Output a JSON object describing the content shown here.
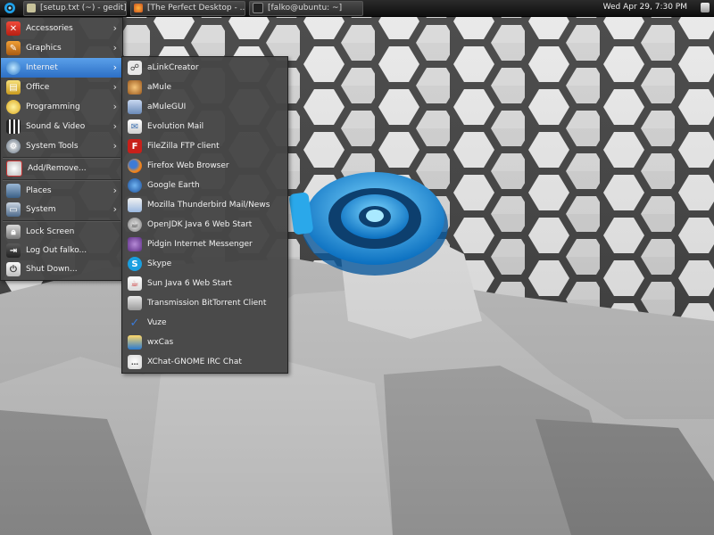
{
  "panel": {
    "tasks": [
      {
        "label": "[setup.txt (~) - gedit]"
      },
      {
        "label": "[The Perfect Desktop - ..."
      },
      {
        "label": "[falko@ubuntu: ~]"
      }
    ],
    "clock": "Wed Apr 29,  7:30 PM"
  },
  "main_menu": {
    "items": [
      {
        "label": "Accessories",
        "icon": "accessories-icon",
        "submenu": true
      },
      {
        "label": "Graphics",
        "icon": "graphics-icon",
        "submenu": true
      },
      {
        "label": "Internet",
        "icon": "internet-icon",
        "submenu": true,
        "highlighted": true
      },
      {
        "label": "Office",
        "icon": "office-icon",
        "submenu": true
      },
      {
        "label": "Programming",
        "icon": "programming-icon",
        "submenu": true
      },
      {
        "label": "Sound & Video",
        "icon": "sound-video-icon",
        "submenu": true
      },
      {
        "label": "System Tools",
        "icon": "system-tools-icon",
        "submenu": true
      },
      {
        "label": "Add/Remove...",
        "icon": "add-remove-icon"
      },
      {
        "label": "Places",
        "icon": "places-icon",
        "submenu": true
      },
      {
        "label": "System",
        "icon": "system-icon",
        "submenu": true
      },
      {
        "label": "Lock Screen",
        "icon": "lock-icon"
      },
      {
        "label": "Log Out falko...",
        "icon": "logout-icon"
      },
      {
        "label": "Shut Down...",
        "icon": "shutdown-icon"
      }
    ]
  },
  "internet_menu": {
    "items": [
      {
        "label": "aLinkCreator",
        "icon": "alinkcreator-icon"
      },
      {
        "label": "aMule",
        "icon": "amule-icon"
      },
      {
        "label": "aMuleGUI",
        "icon": "amulegui-icon"
      },
      {
        "label": "Evolution Mail",
        "icon": "evolution-icon"
      },
      {
        "label": "FileZilla FTP client",
        "icon": "filezilla-icon"
      },
      {
        "label": "Firefox Web Browser",
        "icon": "firefox-icon"
      },
      {
        "label": "Google Earth",
        "icon": "google-earth-icon"
      },
      {
        "label": "Mozilla Thunderbird Mail/News",
        "icon": "thunderbird-icon"
      },
      {
        "label": "OpenJDK Java 6 Web Start",
        "icon": "java-icon"
      },
      {
        "label": "Pidgin Internet Messenger",
        "icon": "pidgin-icon"
      },
      {
        "label": "Skype",
        "icon": "skype-icon"
      },
      {
        "label": "Sun Java 6 Web Start",
        "icon": "sun-java-icon"
      },
      {
        "label": "Transmission BitTorrent Client",
        "icon": "transmission-icon"
      },
      {
        "label": "Vuze",
        "icon": "vuze-icon"
      },
      {
        "label": "wxCas",
        "icon": "wxcas-icon"
      },
      {
        "label": "XChat-GNOME IRC Chat",
        "icon": "xchat-icon"
      }
    ]
  },
  "colors": {
    "highlight": "#3c82d8",
    "menu_bg": "#464646",
    "panel_bg": "#1a1a1a",
    "logo": "#1ea0e8"
  }
}
